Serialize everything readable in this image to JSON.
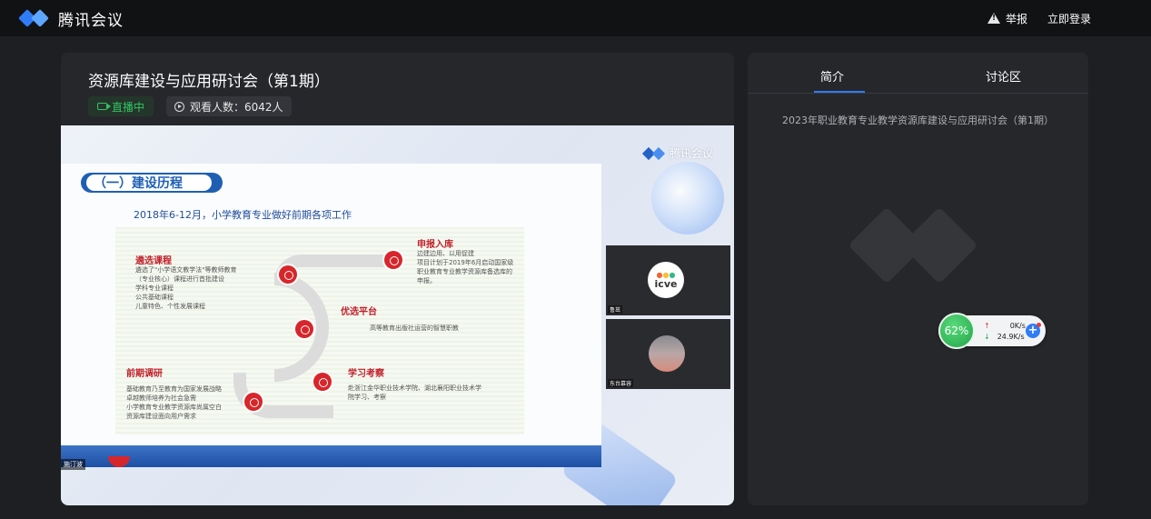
{
  "header": {
    "app_name": "腾讯会议",
    "report_label": "举报",
    "login_label": "立即登录"
  },
  "main": {
    "title": "资源库建设与应用研讨会（第1期）",
    "live_label": "直播中",
    "viewer_label": "观看人数：6042人"
  },
  "video": {
    "watermark": "腾讯会议",
    "slide": {
      "header": "（一）建设历程",
      "subtitle": "2018年6-12月，小学教育专业做好前期各项工作",
      "sections": [
        {
          "title": "遴选课程",
          "text": "遴选了\"小学语文教学法\"等教师教育\n（专业核心）课程进行首批建设\n学科专业课程\n公共基础课程\n儿童特色、个性发展课程"
        },
        {
          "title": "申报入库",
          "text": "边建边用、以用促建\n项目计划于2019年6月启动国家级\n职业教育专业教学资源库备选库的\n申报。"
        },
        {
          "title": "优选平台",
          "text": "高等教育出版社运营的智慧职教"
        },
        {
          "title": "前期调研",
          "text": "基础教育乃至教育为国家发展战略\n卓越教师培养为社会急需\n小学教育专业教学资源库尚属空白\n资源库建设面向用户需求"
        },
        {
          "title": "学习考察",
          "text": "赴浙江金华职业技术学院、湖北襄阳职业技术学\n院学习、考察"
        }
      ],
      "speaker_tag": "施汀波"
    },
    "thumbs": [
      {
        "label": "鲁茁",
        "logo_text": "icve"
      },
      {
        "label": "东台慕容"
      }
    ]
  },
  "side": {
    "tabs": [
      "简介",
      "讨论区"
    ],
    "intro": "2023年职业教育专业教学资源库建设与应用研讨会（第1期）"
  },
  "network": {
    "percent": "62%",
    "up": "0K/s",
    "down": "24.9K/s",
    "up_arrow": "↑",
    "down_arrow": "↓",
    "plus": "+"
  },
  "colors": {
    "accent": "#2f7cf6",
    "live_green": "#34c263",
    "slide_red": "#c0202a"
  }
}
